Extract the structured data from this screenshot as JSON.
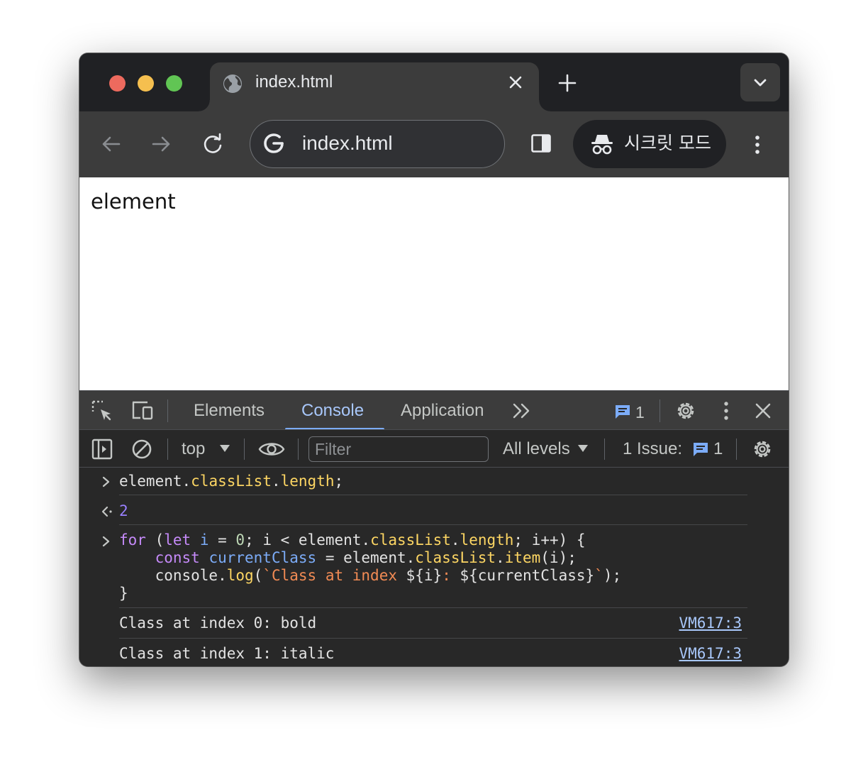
{
  "browser": {
    "tab": {
      "title": "index.html"
    },
    "omnibox": {
      "url": "index.html"
    },
    "incognito_label": "시크릿 모드"
  },
  "page": {
    "text": "element"
  },
  "devtools": {
    "tabs": [
      {
        "label": "Elements",
        "active": false
      },
      {
        "label": "Console",
        "active": true
      },
      {
        "label": "Application",
        "active": false
      }
    ],
    "more_tabs": ">>",
    "messages_count": "1",
    "console_bar": {
      "context": "top",
      "filter_placeholder": "Filter",
      "levels": "All levels",
      "issues_label": "1 Issue:",
      "issues_count": "1"
    }
  },
  "console": {
    "input1": {
      "obj": "element",
      "dot1": ".",
      "prop1": "classList",
      "dot2": ".",
      "prop2": "length",
      "end": ";"
    },
    "result1": "2",
    "loop": {
      "l1": {
        "kw_for": "for",
        "t1": " (",
        "kw_let": "let",
        "t2": " ",
        "var_i": "i",
        "t3": " = ",
        "num0": "0",
        "t4": "; i < element.",
        "p1": "classList",
        "t5": ".",
        "p2": "length",
        "t6": "; i++) {"
      },
      "l2": {
        "indent": "    ",
        "kw_const": "const",
        "t1": " ",
        "var": "currentClass",
        "t2": " = element.",
        "p1": "classList",
        "t3": ".",
        "p2": "item",
        "t4": "(i);"
      },
      "l3": {
        "indent": "    ",
        "t1": "console.",
        "p1": "log",
        "t2": "(",
        "s1": "`Class at index ",
        "t3": "${i}",
        "s2": ": ",
        "t4": "${currentClass}",
        "s3": "`",
        "t5": ");"
      },
      "l4": "}"
    },
    "logs": [
      {
        "text": "Class at index 0: bold",
        "source": "VM617:3"
      },
      {
        "text": "Class at index 1: italic",
        "source": "VM617:3"
      }
    ]
  }
}
